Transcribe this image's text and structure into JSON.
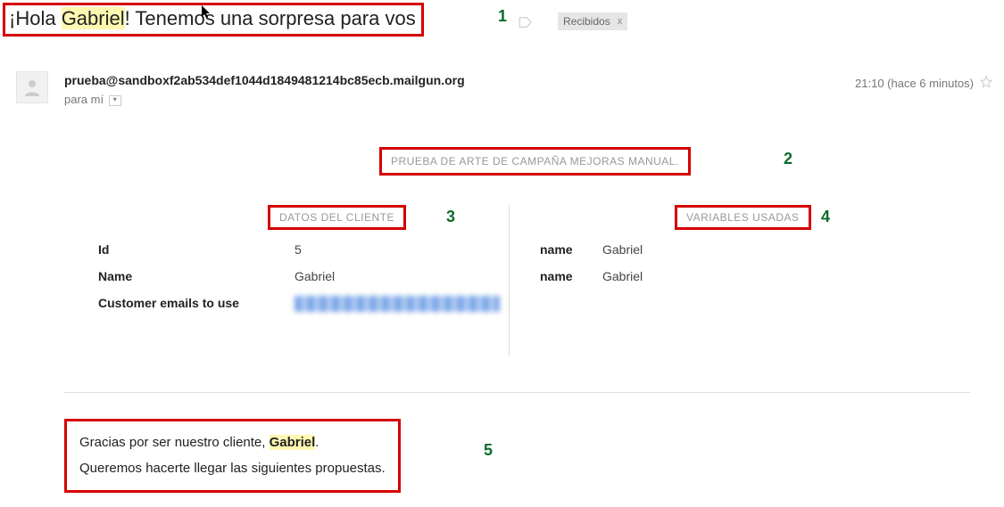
{
  "subject": {
    "prefix": "¡Hola ",
    "highlighted": "Gabriel",
    "suffix": "! Tenemos una sorpresa para vos"
  },
  "label": {
    "text": "Recibidos",
    "close": "x"
  },
  "sender": {
    "email": "prueba@sandboxf2ab534def1044d1849481214bc85ecb.mailgun.org",
    "to": "para mí"
  },
  "time": "21:10 (hace 6 minutos)",
  "campaign_title": "PRUEBA DE ARTE DE CAMPAÑA MEJORAS MANUAL.",
  "sections": {
    "client_data": "DATOS DEL CLIENTE",
    "variables": "VARIABLES USADAS"
  },
  "client": {
    "rows": [
      {
        "key": "Id",
        "val": "5"
      },
      {
        "key": "Name",
        "val": "Gabriel"
      },
      {
        "key": "Customer emails to use",
        "val": ""
      }
    ]
  },
  "variables": {
    "rows": [
      {
        "key": "name",
        "val": "Gabriel"
      },
      {
        "key": "name",
        "val": "Gabriel"
      }
    ]
  },
  "body": {
    "line1_prefix": "Gracias por ser nuestro cliente, ",
    "line1_name": "Gabriel",
    "line1_suffix": ".",
    "line2": "Queremos hacerte llegar las siguientes propuestas."
  },
  "annotations": {
    "n1": "1",
    "n2": "2",
    "n3": "3",
    "n4": "4",
    "n5": "5"
  }
}
